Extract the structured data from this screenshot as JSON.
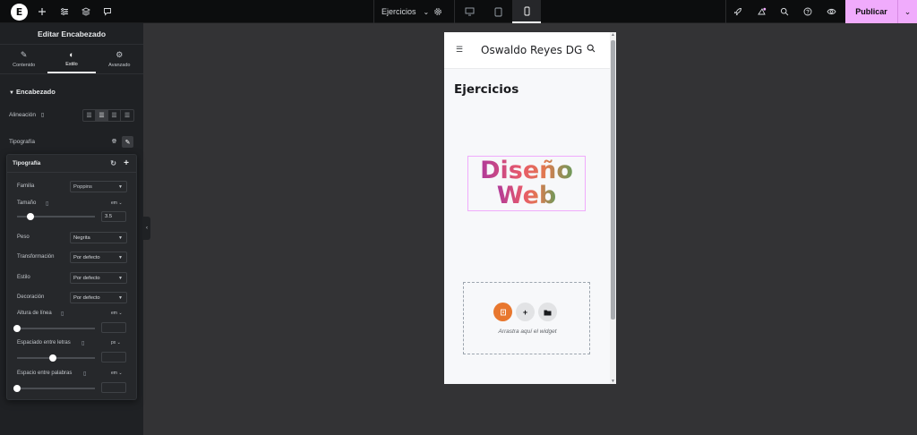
{
  "topbar": {
    "logo": "E",
    "page_selector": "Ejercicios",
    "publish_label": "Publicar"
  },
  "panel": {
    "title": "Editar Encabezado",
    "tabs": [
      {
        "label": "Contenido",
        "icon": "pencil-icon"
      },
      {
        "label": "Estilo",
        "icon": "contrast-icon"
      },
      {
        "label": "Avanzado",
        "icon": "gear-icon"
      }
    ],
    "section": "Encabezado",
    "alignment_label": "Alineación",
    "typography_label": "Tipografía"
  },
  "typography": {
    "title": "Tipografía",
    "family_label": "Familia",
    "family_value": "Poppins",
    "size_label": "Tamaño",
    "size_unit": "em",
    "size_value": "3.5",
    "size_slider_fraction": 0.17,
    "weight_label": "Peso",
    "weight_value": "Negrita",
    "transform_label": "Transformación",
    "transform_value": "Por defecto",
    "style_label": "Estilo",
    "style_value": "Por defecto",
    "decoration_label": "Decoración",
    "decoration_value": "Por defecto",
    "line_height_label": "Altura de línea",
    "line_height_unit": "em",
    "letter_spacing_label": "Espaciado entre letras",
    "letter_spacing_unit": "px",
    "word_spacing_label": "Espacio entre palabras",
    "word_spacing_unit": "em"
  },
  "preview": {
    "site_title": "Oswaldo Reyes DG",
    "page_title": "Ejercicios",
    "heading_line1": "Diseño",
    "heading_line2": "Web",
    "drop_text": "Arrastra aquí el widget"
  },
  "colors": {
    "accent": "#f0abfc",
    "add_widget": "#e8772e"
  }
}
